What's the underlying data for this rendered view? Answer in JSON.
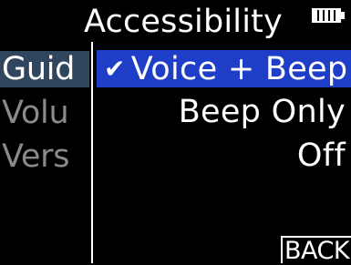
{
  "header": {
    "title": "Accessibility",
    "battery_icon": "battery-icon"
  },
  "sidebar": {
    "items": [
      {
        "label": "Guid",
        "state": "selected"
      },
      {
        "label": "Volu",
        "state": "dim"
      },
      {
        "label": "Vers",
        "state": "dim"
      }
    ]
  },
  "options": {
    "items": [
      {
        "label": "Voice + Beep",
        "checked": true,
        "check_icon": "check-icon"
      },
      {
        "label": "Beep Only",
        "checked": false
      },
      {
        "label": "Off",
        "checked": false
      }
    ],
    "check_glyph": "✔"
  },
  "footer": {
    "back_label": "BACK"
  },
  "colors": {
    "background": "#000000",
    "text": "#ffffff",
    "highlight": "#1f3ec8",
    "sidebar_highlight": "#30455e",
    "dim_text": "#8a8a8a"
  }
}
